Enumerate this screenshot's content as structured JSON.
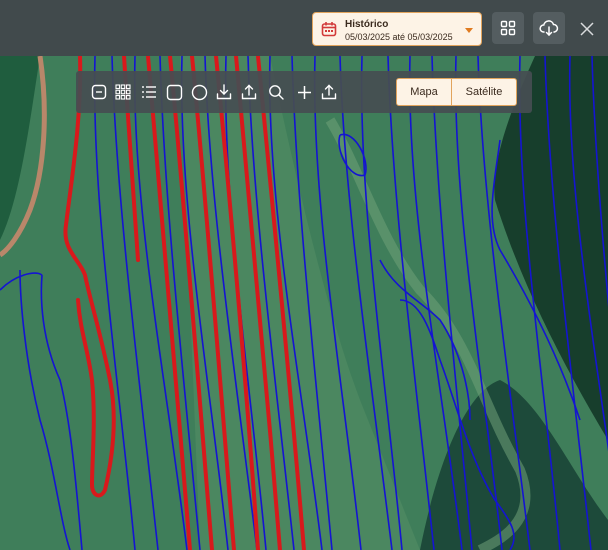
{
  "header": {
    "history": {
      "title": "Histórico",
      "date_range": "05/03/2025 até 05/03/2025",
      "icon": "calendar-icon"
    },
    "buttons": [
      {
        "name": "grid-view-button",
        "icon": "grid-icon"
      },
      {
        "name": "cloud-download-button",
        "icon": "cloud-download-icon"
      },
      {
        "name": "close-button",
        "icon": "close-icon"
      }
    ]
  },
  "toolbar": {
    "tools": [
      {
        "name": "minus-square-tool",
        "icon": "minus-square-icon"
      },
      {
        "name": "grid-tool",
        "icon": "grid-dots-icon"
      },
      {
        "name": "list-tool",
        "icon": "list-icon"
      },
      {
        "name": "rectangle-tool",
        "icon": "square-icon"
      },
      {
        "name": "circle-tool",
        "icon": "circle-icon"
      },
      {
        "name": "download-tool",
        "icon": "download-icon"
      },
      {
        "name": "upload-tool",
        "icon": "upload-icon"
      },
      {
        "name": "search-tool",
        "icon": "search-icon"
      },
      {
        "name": "add-tool",
        "icon": "plus-icon"
      },
      {
        "name": "export-tool",
        "icon": "upload-icon"
      }
    ],
    "map_type": {
      "options": [
        "Mapa",
        "Satélite"
      ],
      "selected": "Satélite"
    }
  },
  "colors": {
    "accent": "#e2a45c",
    "accent_bg": "#fdf3e6",
    "track_blue": "#1414d2",
    "track_red": "#d8191c"
  }
}
